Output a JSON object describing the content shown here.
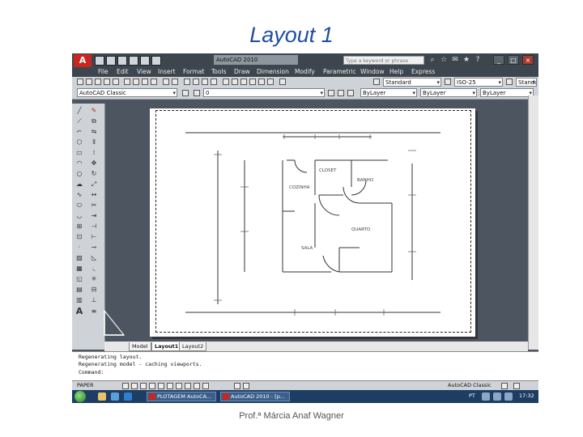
{
  "slide": {
    "title": "Layout 1",
    "footer": "Prof.ª Márcia Anaf Wagner"
  },
  "window": {
    "app_logo": "A",
    "title": "AutoCAD 2010",
    "search_placeholder": "Type a keyword or phrase",
    "controls": [
      "_",
      "□",
      "×"
    ]
  },
  "menu": [
    "File",
    "Edit",
    "View",
    "Insert",
    "Format",
    "Tools",
    "Draw",
    "Dimension",
    "Modify",
    "Parametric",
    "Window",
    "Help",
    "Express"
  ],
  "toolbar": {
    "text_style": "Standard",
    "dim_style": "ISO-25",
    "workspace": "AutoCAD Classic",
    "layer": "0",
    "color": "ByLayer",
    "linetype": "ByLayer",
    "lineweight": "ByLayer"
  },
  "drawing": {
    "rooms": [
      "CLOSET",
      "BANHO",
      "COZINHA",
      "QUARTO",
      "SALA"
    ]
  },
  "tabs": [
    "Model",
    "Layout1",
    "Layout2"
  ],
  "command": {
    "lines": [
      "Regenerating layout.",
      "Regenerating model - caching viewports.",
      "Command:"
    ]
  },
  "status": {
    "coordinates": "PAPER",
    "workspace_label": "AutoCAD Classic"
  },
  "taskbar": {
    "apps": [
      "PLOTAGEM AutoCA...",
      "AutoCAD 2010 - [p..."
    ],
    "language": "PT",
    "time": "17:32"
  },
  "colors": {
    "title_blue": "#1f4fa0",
    "autocad_red": "#c8261e",
    "chrome_dark": "#3d464f",
    "taskbar": "#1e3d63"
  }
}
